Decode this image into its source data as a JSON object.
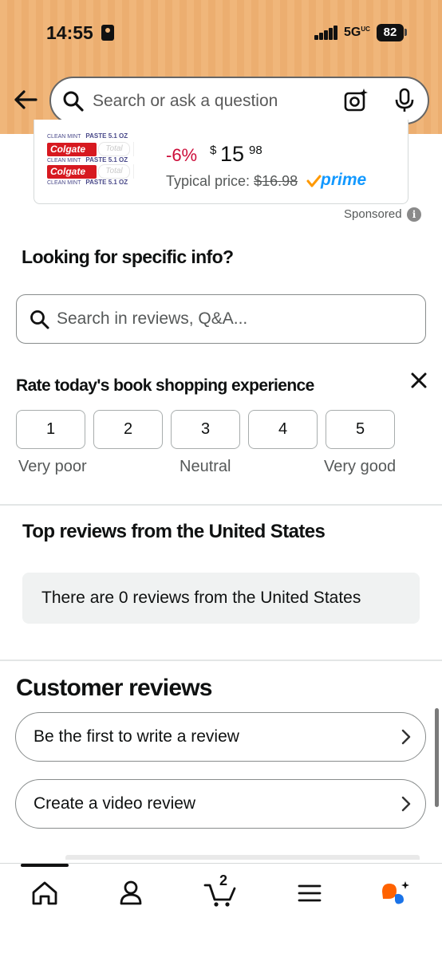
{
  "status_bar": {
    "time": "14:55",
    "network": "5G",
    "network_suffix": "UC",
    "battery": "82",
    "icons": [
      "id-card-icon",
      "signal-icon",
      "battery-icon"
    ]
  },
  "search": {
    "placeholder": "Search or ask a question",
    "icons": [
      "back-arrow-icon",
      "search-icon",
      "camera-icon",
      "microphone-icon"
    ]
  },
  "sponsored_product": {
    "brand": "Colgate",
    "sub_brand": "Total",
    "pack_line": "CLEAN MINT",
    "pack_size": "PASTE 5.1 OZ",
    "discount": "-6%",
    "price_currency": "$",
    "price_whole": "15",
    "price_fraction": "98",
    "typical_label": "Typical price:",
    "typical_price": "$16.98",
    "prime_label": "prime",
    "sponsored_label": "Sponsored",
    "info_symbol": "i"
  },
  "specific_info": {
    "title": "Looking for specific info?",
    "search_placeholder": "Search in reviews, Q&A..."
  },
  "rating": {
    "title": "Rate today's book shopping experience",
    "options": [
      "1",
      "2",
      "3",
      "4",
      "5"
    ],
    "low_label": "Very poor",
    "mid_label": "Neutral",
    "high_label": "Very good"
  },
  "top_reviews": {
    "title": "Top reviews from the United States",
    "empty_message": "There are 0 reviews from the United States"
  },
  "customer_reviews": {
    "title": "Customer reviews",
    "write_review": "Be the first to write a review",
    "video_review": "Create a video review"
  },
  "bottom_nav": {
    "cart_count": "2",
    "items": [
      "home-icon",
      "account-icon",
      "cart-icon",
      "menu-icon",
      "rufus-icon"
    ],
    "accent": "#ff6200",
    "rufus_blue": "#1a73e8"
  },
  "colors": {
    "header_bg": "#f0b67a",
    "discount": "#cc0c39",
    "prime": "#1399ff",
    "prime_check": "#ff9900"
  }
}
